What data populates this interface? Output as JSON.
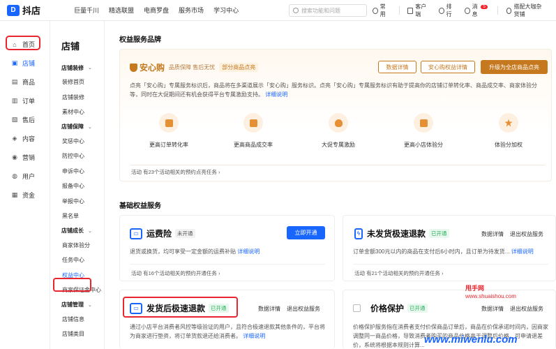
{
  "top": {
    "logo": "抖店",
    "nav": [
      "巨量千川",
      "精选联盟",
      "电商罗盘",
      "服务市场",
      "学习中心"
    ],
    "search_placeholder": "搜索功能和问题",
    "common": "常用",
    "customer": "客户端",
    "queue": "排行",
    "message": "消息",
    "message_badge": "5",
    "account": "搭配大咖杂货铺"
  },
  "leftnav": [
    {
      "label": "首页",
      "icon": "home-icon",
      "glyph": "⌂"
    },
    {
      "label": "店铺",
      "icon": "shop-icon",
      "glyph": "▣",
      "active": true
    },
    {
      "label": "商品",
      "icon": "goods-icon",
      "glyph": "▤"
    },
    {
      "label": "订单",
      "icon": "order-icon",
      "glyph": "▥"
    },
    {
      "label": "售后",
      "icon": "aftersale-icon",
      "glyph": "▧"
    },
    {
      "label": "内容",
      "icon": "content-icon",
      "glyph": "◈"
    },
    {
      "label": "营销",
      "icon": "marketing-icon",
      "glyph": "◉"
    },
    {
      "label": "用户",
      "icon": "user-icon",
      "glyph": "◍"
    },
    {
      "label": "资金",
      "icon": "fund-icon",
      "glyph": "▦"
    }
  ],
  "subnav": {
    "title": "店铺",
    "groups": [
      {
        "label": "店铺装修",
        "items": [
          "装修首页",
          "店铺装修",
          "素材中心"
        ]
      },
      {
        "label": "店铺保障",
        "items": [
          "奖惩中心",
          "防控中心",
          "申诉中心",
          "报备中心",
          "举报中心",
          "黑名单"
        ]
      },
      {
        "label": "店铺成长",
        "items": [
          "商家体验分",
          "任务中心",
          "权益中心",
          "商家保证金中心"
        ]
      },
      {
        "label": "店铺管理",
        "items": [
          "店铺信息",
          "店铺类目"
        ]
      }
    ],
    "active": "权益中心"
  },
  "brand": {
    "section_title": "权益服务品牌",
    "name": "安心购",
    "slogan": "品质保障 售后无忧",
    "part": "部分商品点亮",
    "btn_detail": "数据详情",
    "btn_rights": "安心购权益详情",
    "btn_upgrade": "升级为全店商品点亮",
    "desc": "点亮「安心购」专属服务标识后，商品将在多渠道展示「安心购」服务标识。点亮「安心购」专属服务标识有助于提高你的店铺订单转化率、商品成交率、商家体验分等，同时在大促期间还有机会获得平台专属激励支持。",
    "desc_link": "详细说明",
    "features": [
      "更高订单转化率",
      "更高商品成交率",
      "大促专属激励",
      "更高小店体验分",
      "体验分加权"
    ],
    "activity": "活动  有23个活动相关的预约点亮任务 ›"
  },
  "basic": {
    "section_title": "基础权益服务",
    "yunfei": {
      "name": "运费险",
      "status": "未开通",
      "btn": "立即开通",
      "desc": "退货或换货，均可享受一定金额的运费补贴",
      "desc_link": "详细说明",
      "activity": "活动  有16个活动相关的预约开通任务 ›"
    },
    "weifa": {
      "name": "未发货极速退款",
      "status": "已开通",
      "detail": "数据详情",
      "exit": "退出权益服务",
      "desc": "订单金额300元以内的商品在支付后6小时内，且订单为待发货...",
      "desc_link": "详细说明",
      "activity": "活动  有21个活动相关的预约开通任务 ›"
    },
    "fahuo": {
      "name": "发货后极速退款",
      "status": "已开通",
      "detail": "数据详情",
      "exit": "退出权益服务",
      "desc": "通过小店平台消费者风控等级验证的用户，且符合极速退款其他条件的，平台将为商家进行垫资，将订单货款退还给消费者。",
      "desc_link": "详细说明"
    },
    "jiage": {
      "name": "价格保护",
      "status": "已开通",
      "detail": "数据详情",
      "exit": "退出权益服务",
      "desc": "价格保护服务指在消费者支付价保商品订单后，商品在价保承诺时间内，因商家调整同一商品价格，导致消费者购买的商品价格高于调整后价格，可申请退差价，系统将根据本规则计算..."
    }
  },
  "watermarks": {
    "w1": "甩手网",
    "w2": "www.shuaishou.com",
    "w3": "www.miwenlu.com"
  },
  "colors": {
    "accent": "#1966ff",
    "gold": "#c5781e",
    "highlight": "#e8262d",
    "green": "#2ab15b"
  }
}
